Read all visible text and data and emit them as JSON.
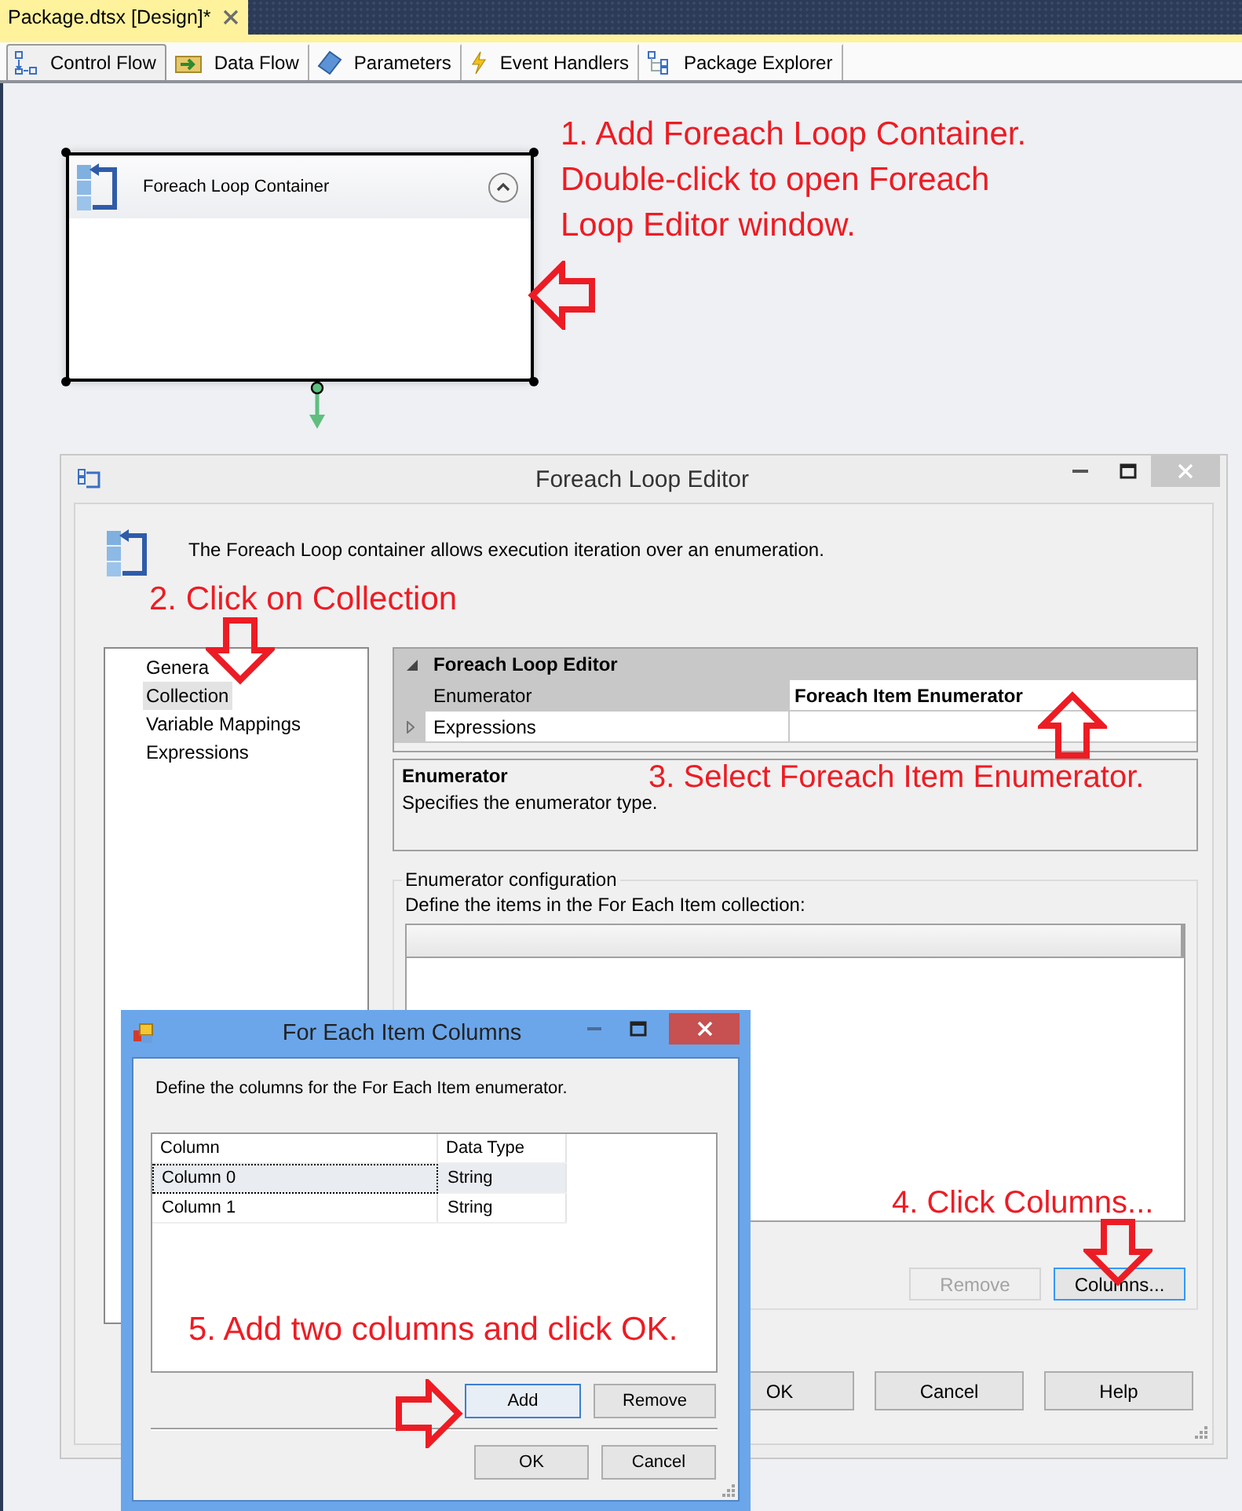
{
  "document_tab": {
    "title": "Package.dtsx [Design]*",
    "selected": true
  },
  "designer_tabs": [
    {
      "label": "Control Flow",
      "selected": true
    },
    {
      "label": "Data Flow",
      "selected": false
    },
    {
      "label": "Parameters",
      "selected": false
    },
    {
      "label": "Event Handlers",
      "selected": false
    },
    {
      "label": "Package Explorer",
      "selected": false
    }
  ],
  "container": {
    "title": "Foreach Loop Container"
  },
  "editor": {
    "title": "Foreach Loop Editor",
    "description": "The Foreach Loop container allows execution iteration over an enumeration.",
    "pages": [
      {
        "label": "Genera",
        "selected": false
      },
      {
        "label": "Collection",
        "selected": true
      },
      {
        "label": "Variable Mappings",
        "selected": false
      },
      {
        "label": "Expressions",
        "selected": false
      }
    ],
    "properties": {
      "category": "Foreach Loop Editor",
      "rows": [
        {
          "name": "Enumerator",
          "value": "Foreach Item Enumerator",
          "selected": true,
          "expandable": false
        },
        {
          "name": "Expressions",
          "selected": false,
          "expandable": true
        }
      ]
    },
    "help": {
      "title": "Enumerator",
      "text": "Specifies the enumerator type."
    },
    "configuration": {
      "title": "Enumerator configuration",
      "instruction": "Define the items in the For Each Item collection:",
      "buttons": [
        {
          "label": "Remove",
          "disabled": true,
          "focused": false
        },
        {
          "label": "Columns...",
          "disabled": false,
          "focused": true
        }
      ]
    },
    "buttons": [
      {
        "label": "OK"
      },
      {
        "label": "Cancel"
      },
      {
        "label": "Help"
      }
    ]
  },
  "columns_dialog": {
    "title": "For Each Item Columns",
    "instruction": "Define the columns for the For Each Item enumerator.",
    "columns": [
      "Column",
      "Data Type"
    ],
    "rows": [
      {
        "cells": [
          "Column 0",
          "String"
        ],
        "selected": true
      },
      {
        "cells": [
          "Column 1",
          "String"
        ],
        "selected": false
      }
    ],
    "actions": [
      {
        "label": "Add",
        "focused": true
      },
      {
        "label": "Remove",
        "focused": false
      }
    ],
    "buttons": [
      {
        "label": "OK"
      },
      {
        "label": "Cancel"
      }
    ]
  },
  "annotations": [
    {
      "lines": [
        "1. Add Foreach Loop Container.",
        "Double-click to open Foreach",
        "Loop Editor window."
      ]
    },
    {
      "lines": [
        "2. Click on Collection"
      ]
    },
    {
      "lines": [
        "3. Select Foreach Item Enumerator."
      ]
    },
    {
      "lines": [
        "4. Click Columns..."
      ]
    },
    {
      "lines": [
        "5. Add two columns and click OK."
      ]
    }
  ]
}
